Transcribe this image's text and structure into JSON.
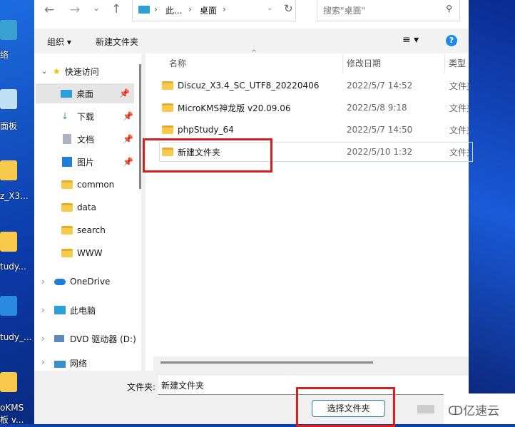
{
  "desktop": {
    "left_labels": [
      "络",
      "面板",
      "z_X3...",
      "tudy...",
      "tudy_...",
      "oKMS",
      "板 v..."
    ]
  },
  "nav": {
    "back": "←",
    "forward": "→",
    "recent": "⌄",
    "up": "↑",
    "breadcrumb": [
      "此...",
      "桌面"
    ],
    "search_placeholder": "搜索\"桌面\""
  },
  "toolbar": {
    "organize": "组织 ▾",
    "new_folder": "新建文件夹",
    "view": "≡ ▾",
    "help": "?"
  },
  "sidebar": {
    "quick_access": "快速访问",
    "items": [
      {
        "label": "桌面",
        "pinned": true
      },
      {
        "label": "下载",
        "pinned": true
      },
      {
        "label": "文档",
        "pinned": true
      },
      {
        "label": "图片",
        "pinned": true
      },
      {
        "label": "common"
      },
      {
        "label": "data"
      },
      {
        "label": "search"
      },
      {
        "label": "WWW"
      }
    ],
    "onedrive": "OneDrive",
    "this_pc": "此电脑",
    "dvd": "DVD 驱动器 (D:)",
    "network": "网络"
  },
  "columns": {
    "name": "名称",
    "date": "修改日期",
    "type": "类型"
  },
  "files": [
    {
      "name": "Discuz_X3.4_SC_UTF8_20220406",
      "date": "2022/5/7 14:52",
      "type": "文件夹"
    },
    {
      "name": "MicroKMS神龙版 v20.09.06",
      "date": "2022/5/8 9:18",
      "type": "文件夹"
    },
    {
      "name": "phpStudy_64",
      "date": "2022/5/7 14:50",
      "type": "文件夹"
    },
    {
      "name": "新建文件夹",
      "date": "2022/5/10 1:32",
      "type": "文件夹"
    }
  ],
  "footer": {
    "folder_label": "文件夹:",
    "folder_value": "新建文件夹",
    "select_button": "选择文件夹"
  },
  "watermark": "亿速云",
  "colors": {
    "highlight": "#d81e1e",
    "accent": "#0078d4"
  }
}
